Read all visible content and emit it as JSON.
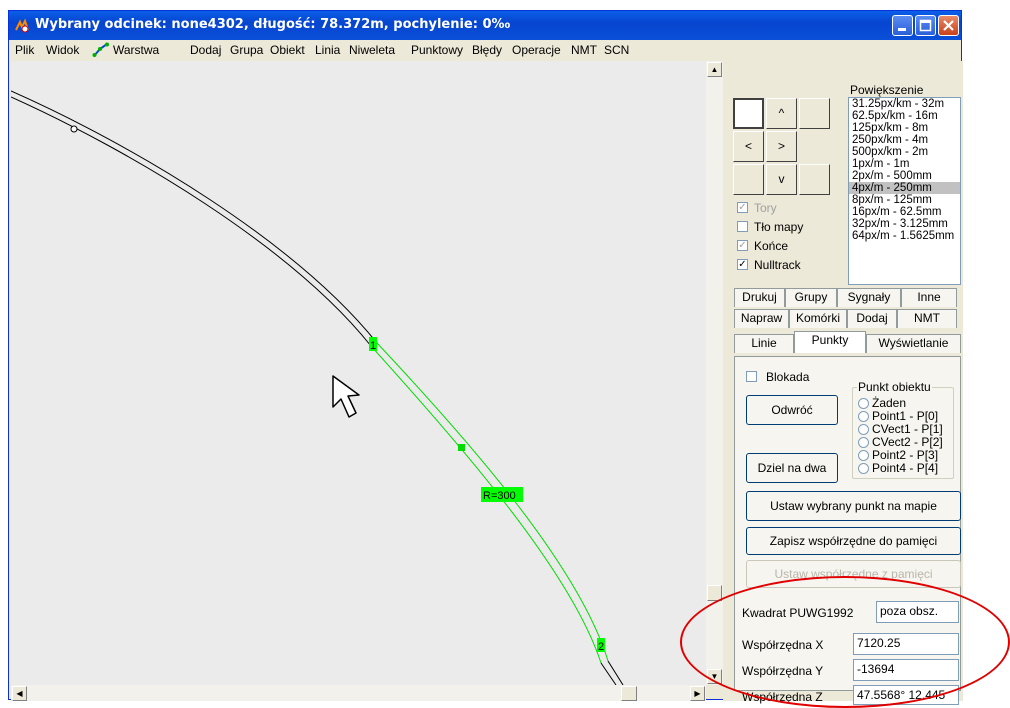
{
  "window": {
    "title": "Wybrany odcinek: none4302, długość: 78.372m, pochylenie: 0‰"
  },
  "menu": [
    "Plik",
    "Widok",
    "Warstwa",
    "Dodaj",
    "Grupa",
    "Obiekt",
    "Linia",
    "Niweleta",
    "Punktowy",
    "Błędy",
    "Operacje",
    "NMT",
    "SCN"
  ],
  "map": {
    "labels": {
      "point1": "1",
      "point2": "2",
      "radius": "R=300"
    },
    "colors": {
      "track": "#000000",
      "selected_track": "#00dd00",
      "label_bg": "#00ff00"
    }
  },
  "navigation": {
    "up": "^",
    "left": "<",
    "right": ">",
    "down": "v"
  },
  "layers": [
    {
      "label": "Tory",
      "checked": true,
      "enabled": false
    },
    {
      "label": "Tło mapy",
      "checked": false,
      "enabled": true
    },
    {
      "label": "Końce",
      "checked": true,
      "enabled": false
    },
    {
      "label": "Nulltrack",
      "checked": true,
      "enabled": true
    }
  ],
  "zoom": {
    "label": "Powiększenie",
    "items": [
      "31.25px/km - 32m",
      "62.5px/km - 16m",
      "125px/km - 8m",
      "250px/km - 4m",
      "500px/km - 2m",
      "1px/m - 1m",
      "2px/m - 500mm",
      "4px/m - 250mm",
      "8px/m - 125mm",
      "16px/m - 62.5mm",
      "32px/m - 3.125mm",
      "64px/m - 1.5625mm"
    ],
    "selected": "4px/m - 250mm"
  },
  "tabs": {
    "row1": [
      "Drukuj",
      "Grupy",
      "Sygnały",
      "Inne"
    ],
    "row2": [
      "Napraw",
      "Komórki",
      "Dodaj",
      "NMT"
    ],
    "row3": [
      "Linie",
      "Punkty",
      "Wyświetlanie"
    ],
    "active": "Punkty"
  },
  "punkty": {
    "blokada_label": "Blokada",
    "odwroc_label": "Odwróć",
    "dziel_label": "Dziel na dwa",
    "group_title": "Punkt obiektu",
    "radios": [
      "Żaden",
      "Point1 - P[0]",
      "CVect1 - P[1]",
      "CVect2 - P[2]",
      "Point2 - P[3]",
      "Point4 - P[4]"
    ],
    "set_point_label": "Ustaw wybrany punkt  na mapie",
    "save_label": "Zapisz współrzędne do pamięci",
    "load_label": "Ustaw współrzędne z pamięci"
  },
  "coords": {
    "square_label": "Kwadrat PUWG1992",
    "square_value": "poza obsz.",
    "x_label": "Współrzędna X",
    "x_value": "7120.25",
    "y_label": "Współrzędna Y",
    "y_value": "-13694",
    "z_label": "Współrzędna Z",
    "z_value": "47.5568° 12.445"
  }
}
